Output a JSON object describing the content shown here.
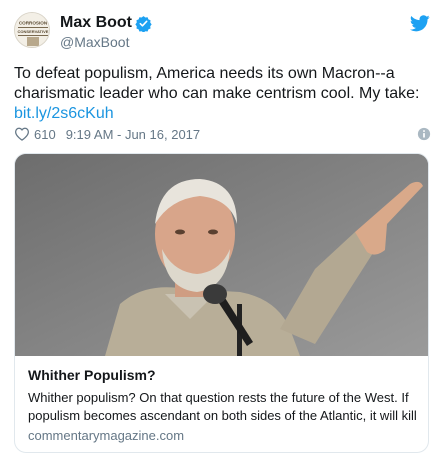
{
  "author": {
    "name": "Max Boot",
    "handle": "@MaxBoot",
    "verified": true,
    "avatar_text": [
      "CORROSION",
      "CONSERVATIVE"
    ]
  },
  "tweet": {
    "text_lines": [
      "To defeat populism, America needs its own Macron--a",
      "charismatic leader who can make centrism cool. My take:"
    ],
    "link": "bit.ly/2s6cKuh",
    "likes": "610",
    "timestamp": "9:19 AM - Jun 16, 2017"
  },
  "card": {
    "title": "Whither Populism?",
    "description_lines": [
      "Whither populism? On that question rests the future of the West. If",
      "populism becomes ascendant on both sides of the Atlantic, it will kill"
    ],
    "domain": "commentarymagazine.com"
  },
  "colors": {
    "twitter_blue": "#1da1f2",
    "link_blue": "#1b95e0",
    "secondary_text": "#657786",
    "border": "#e1e8ed"
  },
  "icons": [
    "verified-badge-icon",
    "twitter-bird-icon",
    "heart-icon",
    "info-icon"
  ]
}
